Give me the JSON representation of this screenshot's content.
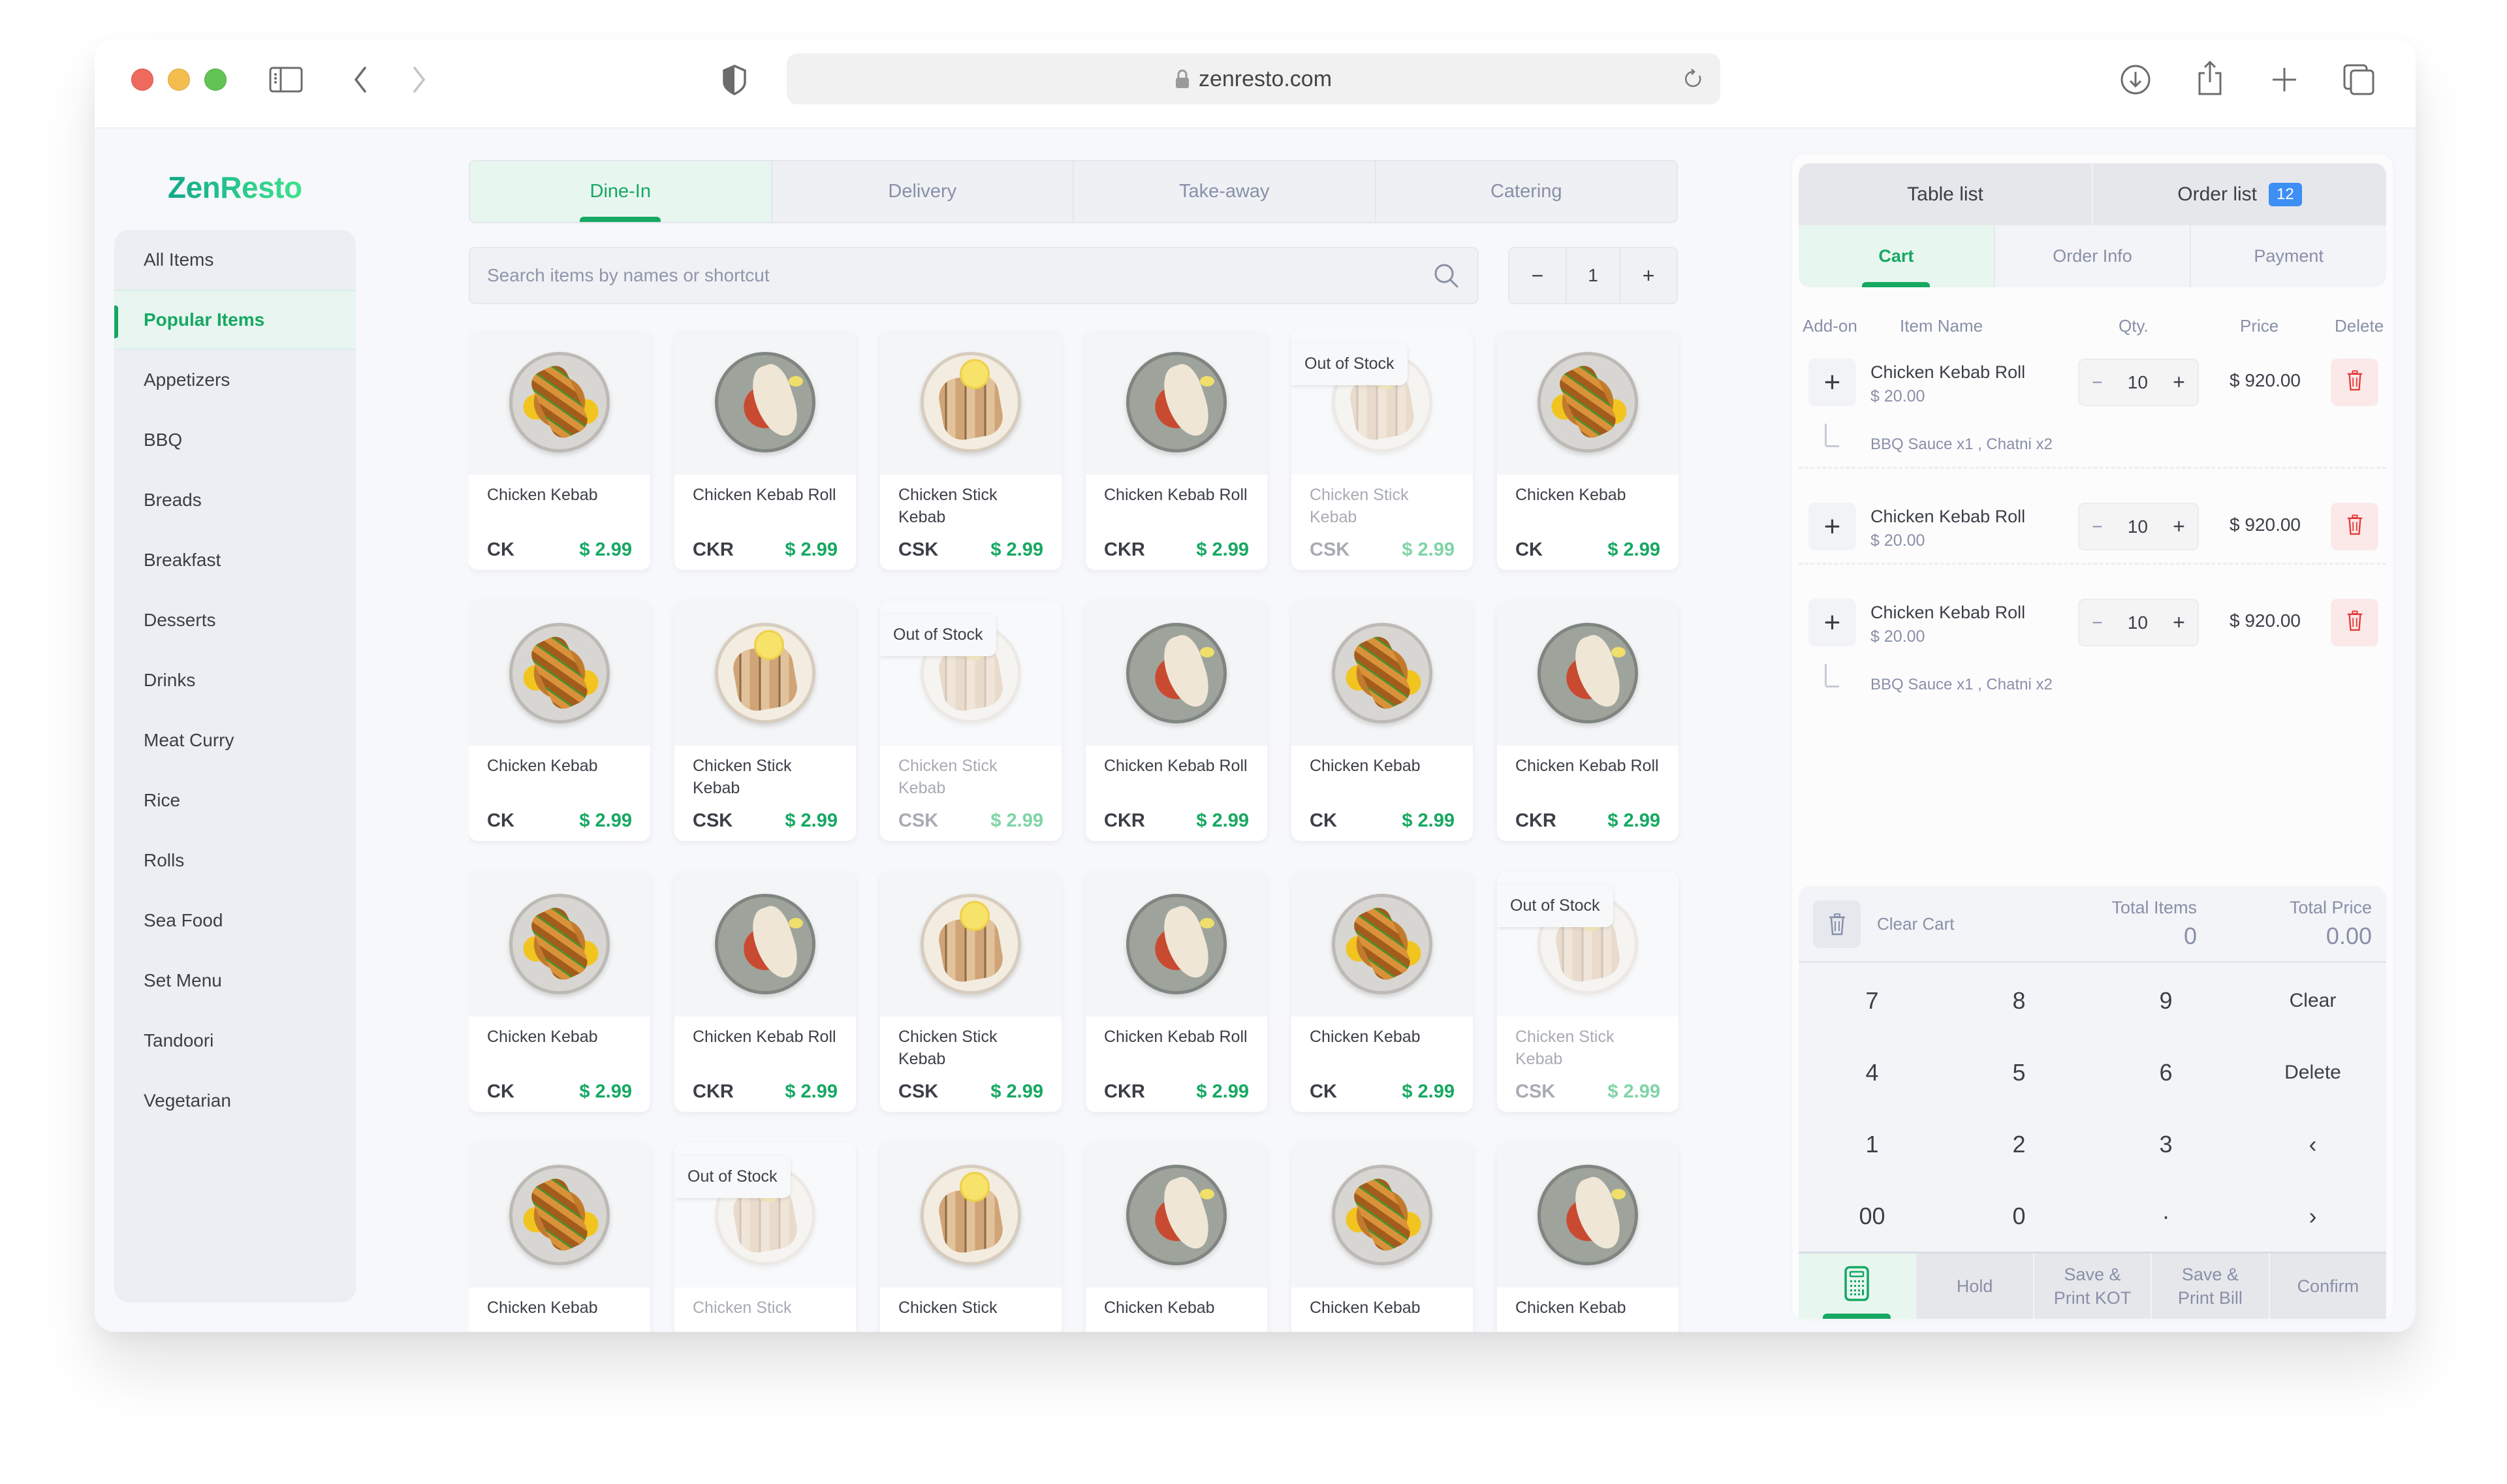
{
  "browser": {
    "url": "zenresto.com",
    "icons": [
      "sidebar-toggle-icon",
      "back-icon",
      "forward-icon",
      "shield-icon",
      "lock-icon",
      "reload-icon",
      "download-icon",
      "share-icon",
      "new-tab-icon",
      "tabs-overview-icon"
    ]
  },
  "app": {
    "logo": "ZenResto"
  },
  "sidebar": {
    "items": [
      {
        "label": "All Items",
        "active": false
      },
      {
        "label": "Popular Items",
        "active": true
      },
      {
        "label": "Appetizers",
        "active": false
      },
      {
        "label": "BBQ",
        "active": false
      },
      {
        "label": "Breads",
        "active": false
      },
      {
        "label": "Breakfast",
        "active": false
      },
      {
        "label": "Desserts",
        "active": false
      },
      {
        "label": "Drinks",
        "active": false
      },
      {
        "label": "Meat Curry",
        "active": false
      },
      {
        "label": "Rice",
        "active": false
      },
      {
        "label": "Rolls",
        "active": false
      },
      {
        "label": "Sea Food",
        "active": false
      },
      {
        "label": "Set Menu",
        "active": false
      },
      {
        "label": "Tandoori",
        "active": false
      },
      {
        "label": "Vegetarian",
        "active": false
      }
    ]
  },
  "order_types": [
    {
      "label": "Dine-In",
      "active": true
    },
    {
      "label": "Delivery",
      "active": false
    },
    {
      "label": "Take-away",
      "active": false
    },
    {
      "label": "Catering",
      "active": false
    }
  ],
  "search": {
    "placeholder": "Search items by names or shortcut",
    "value": ""
  },
  "quantity": {
    "minus": "−",
    "value": "1",
    "plus": "+"
  },
  "out_of_stock_label": "Out of Stock",
  "products": [
    [
      {
        "name": "Chicken Kebab",
        "code": "CK",
        "price": "$ 2.99",
        "dish": "kebab",
        "out_of_stock": false
      },
      {
        "name": "Chicken Kebab Roll",
        "code": "CKR",
        "price": "$ 2.99",
        "dish": "roll",
        "out_of_stock": false
      },
      {
        "name": "Chicken Stick Kebab",
        "code": "CSK",
        "price": "$ 2.99",
        "dish": "stick",
        "out_of_stock": false
      },
      {
        "name": "Chicken Kebab Roll",
        "code": "CKR",
        "price": "$ 2.99",
        "dish": "roll",
        "out_of_stock": false
      },
      {
        "name": "Chicken Stick Kebab",
        "code": "CSK",
        "price": "$ 2.99",
        "dish": "stick",
        "out_of_stock": true
      },
      {
        "name": "Chicken Kebab",
        "code": "CK",
        "price": "$ 2.99",
        "dish": "kebab",
        "out_of_stock": false
      }
    ],
    [
      {
        "name": "Chicken Kebab",
        "code": "CK",
        "price": "$ 2.99",
        "dish": "kebab",
        "out_of_stock": false
      },
      {
        "name": "Chicken Stick Kebab",
        "code": "CSK",
        "price": "$ 2.99",
        "dish": "stick",
        "out_of_stock": false
      },
      {
        "name": "Chicken Stick Kebab",
        "code": "CSK",
        "price": "$ 2.99",
        "dish": "stick",
        "out_of_stock": true
      },
      {
        "name": "Chicken Kebab Roll",
        "code": "CKR",
        "price": "$ 2.99",
        "dish": "roll",
        "out_of_stock": false
      },
      {
        "name": "Chicken Kebab",
        "code": "CK",
        "price": "$ 2.99",
        "dish": "kebab",
        "out_of_stock": false
      },
      {
        "name": "Chicken Kebab Roll",
        "code": "CKR",
        "price": "$ 2.99",
        "dish": "roll",
        "out_of_stock": false
      }
    ],
    [
      {
        "name": "Chicken Kebab",
        "code": "CK",
        "price": "$ 2.99",
        "dish": "kebab",
        "out_of_stock": false
      },
      {
        "name": "Chicken Kebab Roll",
        "code": "CKR",
        "price": "$ 2.99",
        "dish": "roll",
        "out_of_stock": false
      },
      {
        "name": "Chicken Stick Kebab",
        "code": "CSK",
        "price": "$ 2.99",
        "dish": "stick",
        "out_of_stock": false
      },
      {
        "name": "Chicken Kebab Roll",
        "code": "CKR",
        "price": "$ 2.99",
        "dish": "roll",
        "out_of_stock": false
      },
      {
        "name": "Chicken Kebab",
        "code": "CK",
        "price": "$ 2.99",
        "dish": "kebab",
        "out_of_stock": false
      },
      {
        "name": "Chicken Stick Kebab",
        "code": "CSK",
        "price": "$ 2.99",
        "dish": "stick",
        "out_of_stock": true
      }
    ],
    [
      {
        "name": "Chicken Kebab",
        "code": "",
        "price": "",
        "dish": "kebab",
        "out_of_stock": false
      },
      {
        "name": "Chicken Stick",
        "code": "",
        "price": "",
        "dish": "stick",
        "out_of_stock": true
      },
      {
        "name": "Chicken Stick",
        "code": "",
        "price": "",
        "dish": "stick",
        "out_of_stock": false
      },
      {
        "name": "Chicken Kebab",
        "code": "",
        "price": "",
        "dish": "roll",
        "out_of_stock": false
      },
      {
        "name": "Chicken Kebab",
        "code": "",
        "price": "",
        "dish": "kebab",
        "out_of_stock": false
      },
      {
        "name": "Chicken Kebab",
        "code": "",
        "price": "",
        "dish": "roll",
        "out_of_stock": false
      }
    ]
  ],
  "panel": {
    "top_tabs": [
      {
        "label": "Table list"
      },
      {
        "label": "Order list",
        "badge": "12"
      }
    ],
    "sub_tabs": [
      {
        "label": "Cart",
        "active": true
      },
      {
        "label": "Order Info",
        "active": false
      },
      {
        "label": "Payment",
        "active": false
      }
    ],
    "columns": {
      "addon": "Add-on",
      "item": "Item Name",
      "qty": "Qty.",
      "price": "Price",
      "delete": "Delete"
    },
    "cart_items": [
      {
        "name": "Chicken Kebab Roll",
        "unit_price": "$ 20.00",
        "qty": "10",
        "total": "$ 920.00",
        "addons": "BBQ Sauce x1 , Chatni x2"
      },
      {
        "name": "Chicken Kebab Roll",
        "unit_price": "$ 20.00",
        "qty": "10",
        "total": "$ 920.00",
        "addons": ""
      },
      {
        "name": "Chicken Kebab Roll",
        "unit_price": "$ 20.00",
        "qty": "10",
        "total": "$ 920.00",
        "addons": "BBQ Sauce x1 , Chatni x2"
      }
    ],
    "summary": {
      "clear_cart": "Clear Cart",
      "total_items_label": "Total Items",
      "total_items": "0",
      "total_price_label": "Total Price",
      "total_price": "0.00"
    },
    "keypad": [
      "7",
      "8",
      "9",
      "Clear",
      "4",
      "5",
      "6",
      "Delete",
      "1",
      "2",
      "3",
      "‹",
      "00",
      "0",
      "·",
      "›"
    ],
    "actions": [
      {
        "label": "",
        "icon": "calculator-icon",
        "active": true
      },
      {
        "label": "Hold",
        "active": false
      },
      {
        "label": "Save &\nPrint KOT",
        "active": false
      },
      {
        "label": "Save &\nPrint Bill",
        "active": false
      },
      {
        "label": "Confirm",
        "active": false
      }
    ]
  },
  "colors": {
    "accent": "#16a862",
    "badge": "#3d8ef5",
    "delete": "#e53935",
    "muted": "#8890a8"
  }
}
